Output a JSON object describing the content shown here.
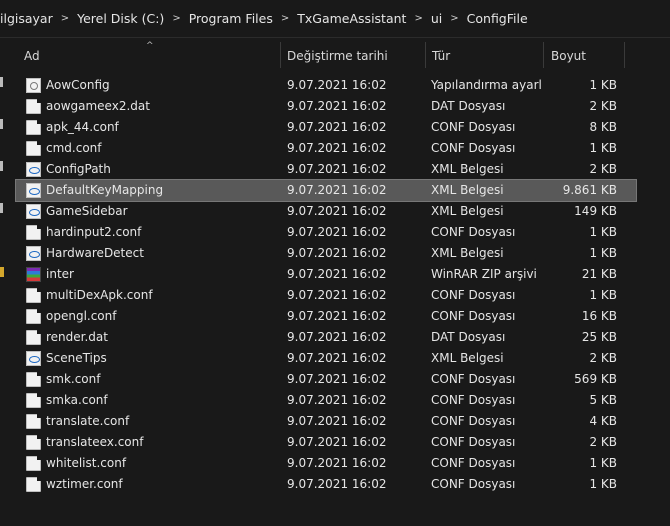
{
  "breadcrumb": [
    "ilgisayar",
    "Yerel Disk (C:)",
    "Program Files",
    "TxGameAssistant",
    "ui",
    "ConfigFile"
  ],
  "columns": {
    "name": "Ad",
    "date": "Değiştirme tarihi",
    "type": "Tür",
    "size": "Boyut"
  },
  "files": [
    {
      "name": "AowConfig",
      "date": "9.07.2021 16:02",
      "type": "Yapılandırma ayarl...",
      "size": "1 KB",
      "icon": "config-file-icon"
    },
    {
      "name": "aowgameex2.dat",
      "date": "9.07.2021 16:02",
      "type": "DAT Dosyası",
      "size": "2 KB",
      "icon": "document-icon"
    },
    {
      "name": "apk_44.conf",
      "date": "9.07.2021 16:02",
      "type": "CONF Dosyası",
      "size": "8 KB",
      "icon": "document-icon"
    },
    {
      "name": "cmd.conf",
      "date": "9.07.2021 16:02",
      "type": "CONF Dosyası",
      "size": "1 KB",
      "icon": "document-icon"
    },
    {
      "name": "ConfigPath",
      "date": "9.07.2021 16:02",
      "type": "XML Belgesi",
      "size": "2 KB",
      "icon": "xml-file-icon"
    },
    {
      "name": "DefaultKeyMapping",
      "date": "9.07.2021 16:02",
      "type": "XML Belgesi",
      "size": "9.861 KB",
      "icon": "xml-file-icon",
      "selected": true
    },
    {
      "name": "GameSidebar",
      "date": "9.07.2021 16:02",
      "type": "XML Belgesi",
      "size": "149 KB",
      "icon": "xml-file-icon"
    },
    {
      "name": "hardinput2.conf",
      "date": "9.07.2021 16:02",
      "type": "CONF Dosyası",
      "size": "1 KB",
      "icon": "document-icon"
    },
    {
      "name": "HardwareDetect",
      "date": "9.07.2021 16:02",
      "type": "XML Belgesi",
      "size": "1 KB",
      "icon": "xml-file-icon"
    },
    {
      "name": "inter",
      "date": "9.07.2021 16:02",
      "type": "WinRAR ZIP arşivi",
      "size": "21 KB",
      "icon": "winrar-archive-icon"
    },
    {
      "name": "multiDexApk.conf",
      "date": "9.07.2021 16:02",
      "type": "CONF Dosyası",
      "size": "1 KB",
      "icon": "document-icon"
    },
    {
      "name": "opengl.conf",
      "date": "9.07.2021 16:02",
      "type": "CONF Dosyası",
      "size": "16 KB",
      "icon": "document-icon"
    },
    {
      "name": "render.dat",
      "date": "9.07.2021 16:02",
      "type": "DAT Dosyası",
      "size": "25 KB",
      "icon": "document-icon"
    },
    {
      "name": "SceneTips",
      "date": "9.07.2021 16:02",
      "type": "XML Belgesi",
      "size": "2 KB",
      "icon": "xml-file-icon"
    },
    {
      "name": "smk.conf",
      "date": "9.07.2021 16:02",
      "type": "CONF Dosyası",
      "size": "569 KB",
      "icon": "document-icon"
    },
    {
      "name": "smka.conf",
      "date": "9.07.2021 16:02",
      "type": "CONF Dosyası",
      "size": "5 KB",
      "icon": "document-icon"
    },
    {
      "name": "translate.conf",
      "date": "9.07.2021 16:02",
      "type": "CONF Dosyası",
      "size": "4 KB",
      "icon": "document-icon"
    },
    {
      "name": "translateex.conf",
      "date": "9.07.2021 16:02",
      "type": "CONF Dosyası",
      "size": "2 KB",
      "icon": "document-icon"
    },
    {
      "name": "whitelist.conf",
      "date": "9.07.2021 16:02",
      "type": "CONF Dosyası",
      "size": "1 KB",
      "icon": "document-icon"
    },
    {
      "name": "wztimer.conf",
      "date": "9.07.2021 16:02",
      "type": "CONF Dosyası",
      "size": "1 KB",
      "icon": "document-icon"
    }
  ]
}
